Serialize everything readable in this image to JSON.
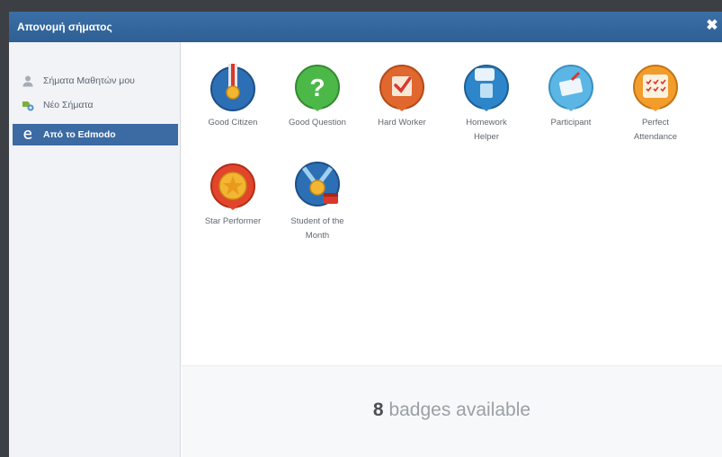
{
  "dialog": {
    "title": "Απονομή σήματος",
    "close_glyph": "✖"
  },
  "sidebar": {
    "items": [
      {
        "label": "Σήματα Μαθητών μου",
        "icon": "user-icon",
        "active": false
      },
      {
        "label": "Νέο Σήματα",
        "icon": "badge-add-icon",
        "active": false
      },
      {
        "label": "Από το Edmodo",
        "icon": "edmodo-icon",
        "active": true
      }
    ]
  },
  "badges": [
    {
      "label": "Good Citizen",
      "icon": "medal-icon",
      "color": "#2d6fb5"
    },
    {
      "label": "Good Question",
      "icon": "question-icon",
      "color": "#4cb848"
    },
    {
      "label": "Hard Worker",
      "icon": "checklist-icon",
      "color": "#e0672d"
    },
    {
      "label": "Homework Helper",
      "icon": "speech-bubble-icon",
      "color": "#2d86c9"
    },
    {
      "label": "Participant",
      "icon": "ballot-icon",
      "color": "#5bb6e6"
    },
    {
      "label": "Perfect Attendance",
      "icon": "calendar-icon",
      "color": "#f29c2b"
    },
    {
      "label": "Star Performer",
      "icon": "star-icon",
      "color": "#e2452b"
    },
    {
      "label": "Student of the Month",
      "icon": "month-medal-icon",
      "color": "#2d6fb5"
    }
  ],
  "footer": {
    "count": "8",
    "suffix": " badges available"
  }
}
